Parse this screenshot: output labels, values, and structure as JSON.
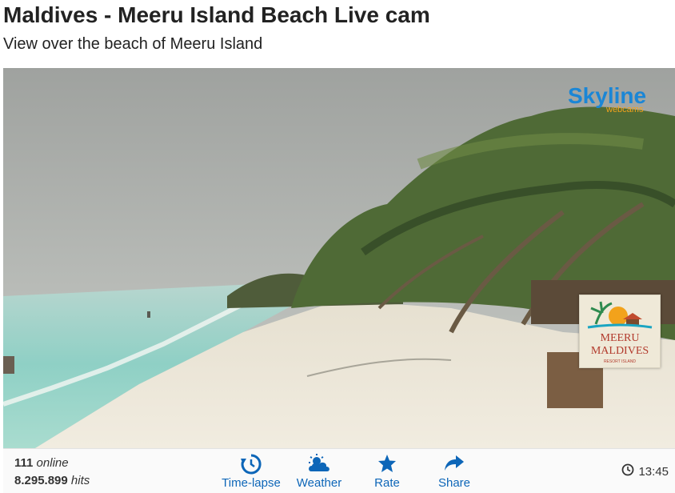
{
  "page": {
    "title": "Maldives - Meeru Island Beach Live cam",
    "subtitle": "View over the beach of Meeru Island"
  },
  "player": {
    "brand_logo": {
      "word": "Skyline",
      "tagline": "webcams",
      "color": "#1a86d6"
    },
    "partner_logo": {
      "line1": "MEERU",
      "line2": "MALDIVES",
      "line3": "RESORT ISLAND",
      "color": "#b23a2c"
    }
  },
  "stats": {
    "online_count": "111",
    "online_label": "online",
    "hits_count": "8.295.899",
    "hits_label": "hits"
  },
  "actions": [
    {
      "label": "Time-lapse",
      "icon": "timelapse-icon"
    },
    {
      "label": "Weather",
      "icon": "weather-icon"
    },
    {
      "label": "Rate",
      "icon": "star-icon"
    },
    {
      "label": "Share",
      "icon": "share-icon"
    }
  ],
  "clock": {
    "time": "13:45",
    "icon": "clock-icon"
  },
  "colors": {
    "accent": "#0d66b8",
    "sky": "#a9aca8",
    "sea": "#8fd0c5",
    "sand": "#e9e2d2"
  }
}
